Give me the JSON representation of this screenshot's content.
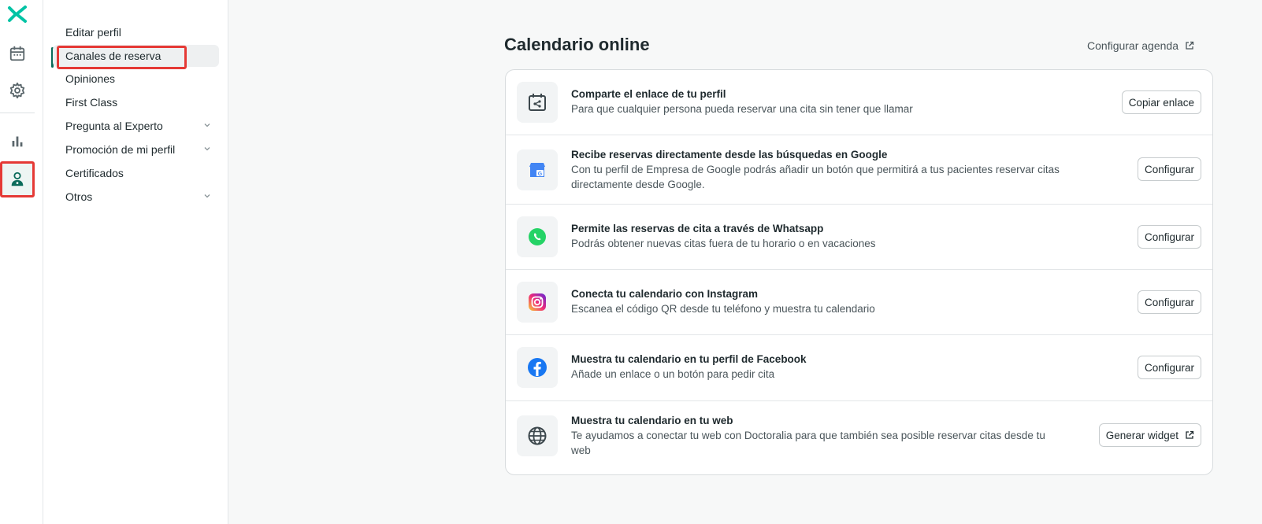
{
  "subnav": {
    "items": [
      {
        "label": "Editar perfil"
      },
      {
        "label": "Canales de reserva"
      },
      {
        "label": "Opiniones"
      },
      {
        "label": "First Class"
      },
      {
        "label": "Pregunta al Experto"
      },
      {
        "label": "Promoción de mi perfil"
      },
      {
        "label": "Certificados"
      },
      {
        "label": "Otros"
      }
    ]
  },
  "main": {
    "title": "Calendario online",
    "config_link": "Configurar agenda"
  },
  "channels": [
    {
      "title": "Comparte el enlace de tu perfil",
      "desc": "Para que cualquier persona pueda reservar una cita sin tener que llamar",
      "button": "Copiar enlace",
      "icon": "share-calendar-icon"
    },
    {
      "title": "Recibe reservas directamente desde las búsquedas en Google",
      "desc": "Con tu perfil de Empresa de Google podrás añadir un botón que permitirá a tus pacientes reservar citas directamente desde Google.",
      "button": "Configurar",
      "icon": "google-business-icon"
    },
    {
      "title": "Permite las reservas de cita a través de Whatsapp",
      "desc": "Podrás obtener nuevas citas fuera de tu horario o en vacaciones",
      "button": "Configurar",
      "icon": "whatsapp-icon"
    },
    {
      "title": "Conecta tu calendario con Instagram",
      "desc": "Escanea el código QR desde tu teléfono y muestra tu calendario",
      "button": "Configurar",
      "icon": "instagram-icon"
    },
    {
      "title": "Muestra tu calendario en tu perfil de Facebook",
      "desc": "Añade un enlace o un botón para pedir cita",
      "button": "Configurar",
      "icon": "facebook-icon"
    },
    {
      "title": "Muestra tu calendario en tu web",
      "desc": "Te ayudamos a conectar tu web con Doctoralia para que también sea posible reservar citas desde tu web",
      "button": "Generar widget",
      "icon": "globe-icon"
    }
  ],
  "colors": {
    "brand": "#00c3a5",
    "accent_dark": "#0b6b5a",
    "highlight": "#e53935"
  }
}
